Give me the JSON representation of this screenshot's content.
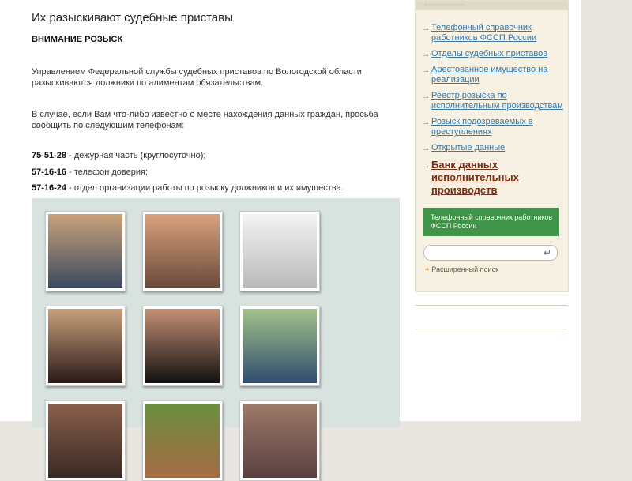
{
  "main": {
    "title": "Их разыскивают судебные приставы",
    "subtitle": "ВНИМАНИЕ РОЗЫСК",
    "paragraph1": "Управлением Федеральной службы судебных приставов по Вологодской области разыскиваются должники по алиментам обязательствам.",
    "paragraph2": "В случае, если Вам что-либо известно о месте нахождения данных граждан, просьба сообщить по следующим телефонам:",
    "phones": [
      {
        "number": "75-51-28",
        "description": " - дежурная часть (круглосуточно);"
      },
      {
        "number": "57-16-16",
        "description": " - телефон доверия;"
      },
      {
        "number": "57-16-24",
        "description": " - отдел организации работы по розыску должников и их имущества."
      }
    ],
    "photos": [
      {
        "name": "photo-1",
        "colors": [
          "#c9a27a",
          "#3c4a60"
        ]
      },
      {
        "name": "photo-2",
        "colors": [
          "#d9a27e",
          "#6b4a3a"
        ]
      },
      {
        "name": "photo-3",
        "colors": [
          "#f3f3f3",
          "#b9b9b9"
        ]
      },
      {
        "name": "photo-4",
        "colors": [
          "#c8a07c",
          "#2b1a18"
        ]
      },
      {
        "name": "photo-5",
        "colors": [
          "#c58f74",
          "#111111"
        ]
      },
      {
        "name": "photo-6",
        "colors": [
          "#a3c28a",
          "#2f4d6f"
        ]
      },
      {
        "name": "photo-7",
        "colors": [
          "#8a5f4a",
          "#3a2a24"
        ]
      },
      {
        "name": "photo-8",
        "colors": [
          "#6a8f3f",
          "#a66a44"
        ]
      },
      {
        "name": "photo-9",
        "colors": [
          "#9d7a6a",
          "#5a4040"
        ]
      }
    ]
  },
  "sidebar": {
    "links": [
      "Телефонный справочник работников ФССП России",
      "Отделы судебных приставов",
      "Арестованное имущество на реализации",
      "Реестр розыска по исполнительным производствам",
      "Розыск подозреваемых в преступлениях",
      "Открытые данные"
    ],
    "bank_link": "Банк данных исполнительных производств",
    "green_button": "Телефонный справочник работников ФССП России",
    "search_enter_icon": "↵",
    "advanced_search": "Расширенный поиск",
    "advanced_plus": "+"
  },
  "colors": {
    "link": "#3a78a8",
    "bank_link": "#7a2e1a",
    "green_button": "#3f9449",
    "gallery_bg": "#d8e3e0"
  }
}
